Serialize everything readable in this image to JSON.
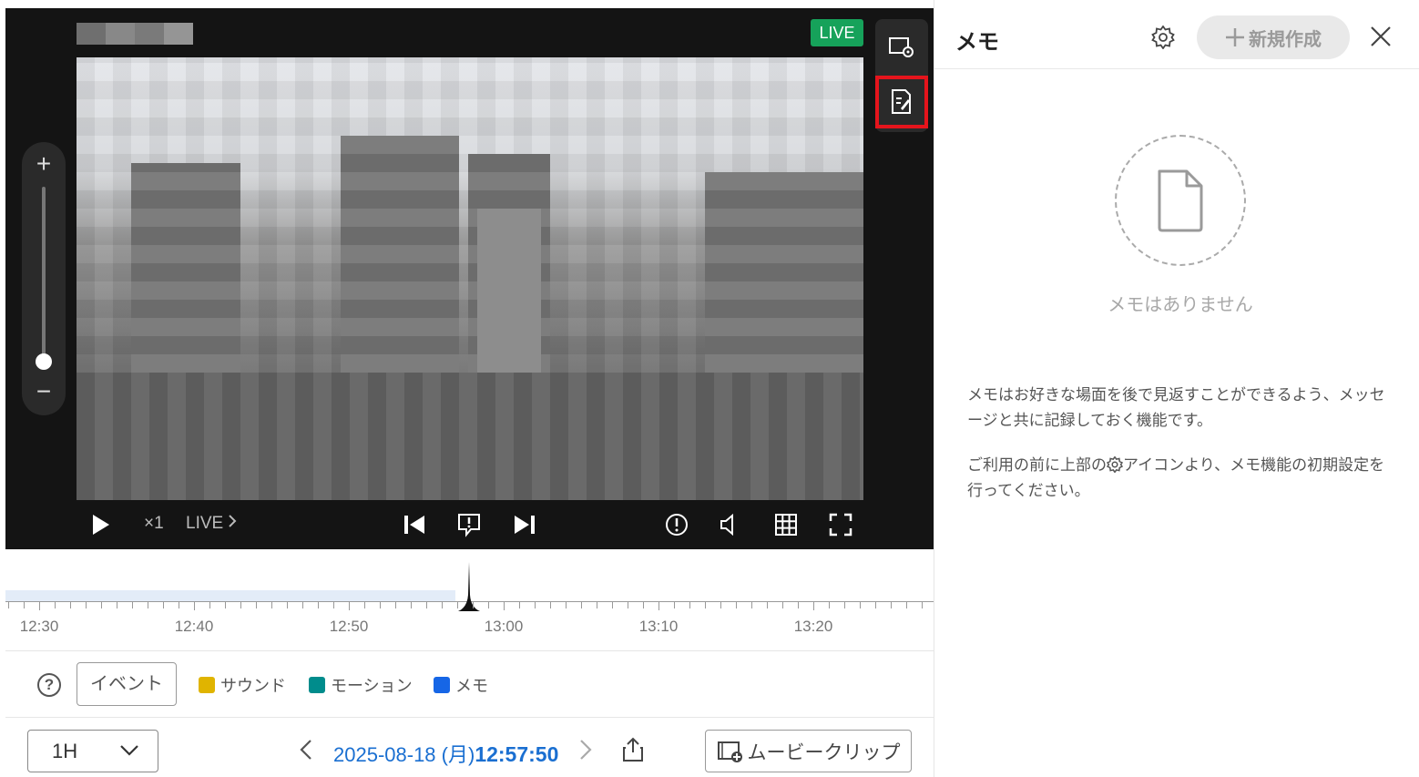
{
  "player": {
    "live_badge": "LIVE",
    "speed": "×1",
    "live_button": "LIVE",
    "zoom_plus": "+",
    "zoom_minus": "−",
    "zoom_level": 0.05
  },
  "timeline": {
    "labels": [
      "12:30",
      "12:40",
      "12:50",
      "13:00",
      "13:10",
      "13:20"
    ]
  },
  "legend": {
    "event_button": "イベント",
    "help": "?",
    "items": [
      {
        "label": "サウンド",
        "color": "#e0b400"
      },
      {
        "label": "モーション",
        "color": "#008c8c"
      },
      {
        "label": "メモ",
        "color": "#1666e6"
      }
    ]
  },
  "controls": {
    "range": "1H",
    "date": "2025-08-18 (月)",
    "time": "12:57:50",
    "clip_button": "ムービークリップ"
  },
  "memo": {
    "title": "メモ",
    "new_button": "新規作成",
    "empty": "メモはありません",
    "desc1": "メモはお好きな場面を後で見返すことができるよう、メッセージと共に記録しておく機能です。",
    "desc2_a": "ご利用の前に上部の",
    "desc2_b": "アイコンより、メモ機能の初期設定を行ってください。"
  },
  "colors": {
    "live": "#16a25a",
    "accent_blue": "#1a6fd1",
    "highlight": "#e5141c"
  }
}
